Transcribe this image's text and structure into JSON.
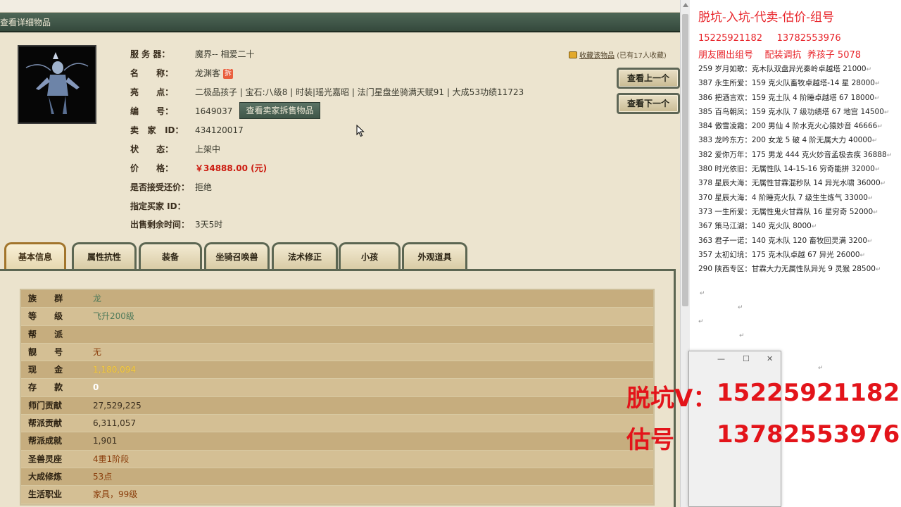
{
  "window": {
    "title": "查看详细物品"
  },
  "item": {
    "rows": [
      {
        "label": "服 务 器：",
        "value": "魔界-- 相爱二十"
      },
      {
        "label": "名      称：",
        "value": "龙渊客"
      },
      {
        "label": "亮      点：",
        "value": "二极品孩子 | 宝石:八级8 | 时装|瑶光嘉昭 | 法门星盘坐骑满天赋91 | 大成53功绩11723"
      },
      {
        "label": "编      号：",
        "value": "1649037"
      },
      {
        "label": "卖   家   ID：",
        "value": "434120017"
      },
      {
        "label": "状      态：",
        "value": "上架中"
      },
      {
        "label": "价      格：",
        "value": "￥34888.00 (元)"
      },
      {
        "label": "是否接受还价：",
        "value": "拒绝"
      },
      {
        "label": "指定买家 ID：",
        "value": ""
      },
      {
        "label": "出售剩余时间：",
        "value": "3天5时"
      }
    ],
    "name_badge": "拆",
    "view_seller_label": "查看卖家拆售物品",
    "collect_text": "收藏该物品",
    "collect_count": "(已有17人收藏)"
  },
  "nav": {
    "prev_label": "查看上一个",
    "next_label": "查看下一个"
  },
  "tabs": [
    {
      "label": "基本信息",
      "active": true
    },
    {
      "label": "属性抗性",
      "active": false
    },
    {
      "label": "装备",
      "active": false
    },
    {
      "label": "坐骑召唤兽",
      "active": false
    },
    {
      "label": "法术修正",
      "active": false
    },
    {
      "label": "小孩",
      "active": false
    },
    {
      "label": "外观道具",
      "active": false
    }
  ],
  "attributes": [
    {
      "label": "族      群",
      "value": "龙",
      "style": "green"
    },
    {
      "label": "等      级",
      "value": "飞升200级",
      "style": "green"
    },
    {
      "label": "帮      派",
      "value": "",
      "style": "plain"
    },
    {
      "label": "靓      号",
      "value": "无",
      "style": "orange"
    },
    {
      "label": "现      金",
      "value": "1,180,094",
      "style": "gold"
    },
    {
      "label": "存      款",
      "value": "0",
      "style": "white"
    },
    {
      "label": "师门贡献",
      "value": "27,529,225",
      "style": "plain"
    },
    {
      "label": "帮派贡献",
      "value": "6,311,057",
      "style": "plain"
    },
    {
      "label": "帮派成就",
      "value": "1,901",
      "style": "plain"
    },
    {
      "label": "圣兽灵座",
      "value": "4重1阶段",
      "style": "orange"
    },
    {
      "label": "大成修炼",
      "value": "53点",
      "style": "orange"
    },
    {
      "label": "生活职业",
      "value": "家具，99级",
      "style": "orange"
    }
  ],
  "notes": {
    "title": "脱坑-入坑-代卖-估价-组号",
    "phones": "15225921182     13782553976",
    "subtitle": "朋友圈出组号    配装调抗  养孩子 5078",
    "listings": [
      "259 岁月如歌：克木队双盘异光秦岭卓越塔 21000",
      "387 永生所爱：159 克火队畜牧卓越塔-14 星 28000",
      "386 把酒言欢：159 克土队 4 阶睡卓越塔 67  18000",
      "385 百鸟朝凤：159 克水队 7 级功绩塔 67 地宫 14500",
      "384 傲雪凌霜：200 男仙 4 阶水克火心猿妙音 46666",
      "383 龙吟东方：200 女龙 5 破 4 阶无属大力 40000",
      "382 爱你万年：175 男龙 444 克火妙音孟极去疾 36888",
      "380 时光依旧：无属性队 14-15-16 穷奇能拼 32000",
      "378 星辰大海：无属性甘霖混秒队 14 异光水啸 36000",
      "370 星辰大海：4 阶睡克火队 7 级生生炼气 33000",
      "373 一生所爱：无属性鬼火甘霖队 16 星穷奇 52000",
      "367 策马江湖：140 克火队 8000",
      "363 君子一诺：140 克木队 120 畜牧回灵满 3200",
      "357 太初幻境：175 克木队卓越 67 异光 26000",
      "290 陕西专区：甘霖大力无属性队异光 9 灵猴 28500"
    ]
  },
  "overlay": {
    "line1_label": "脱坑V：",
    "line1_number": "15225921182",
    "line2_label": "估号",
    "line2_number": "13782553976"
  },
  "colors": {
    "price": "#cc1b10",
    "overlay_red": "#e3141a",
    "header_green": "#3f5648"
  }
}
